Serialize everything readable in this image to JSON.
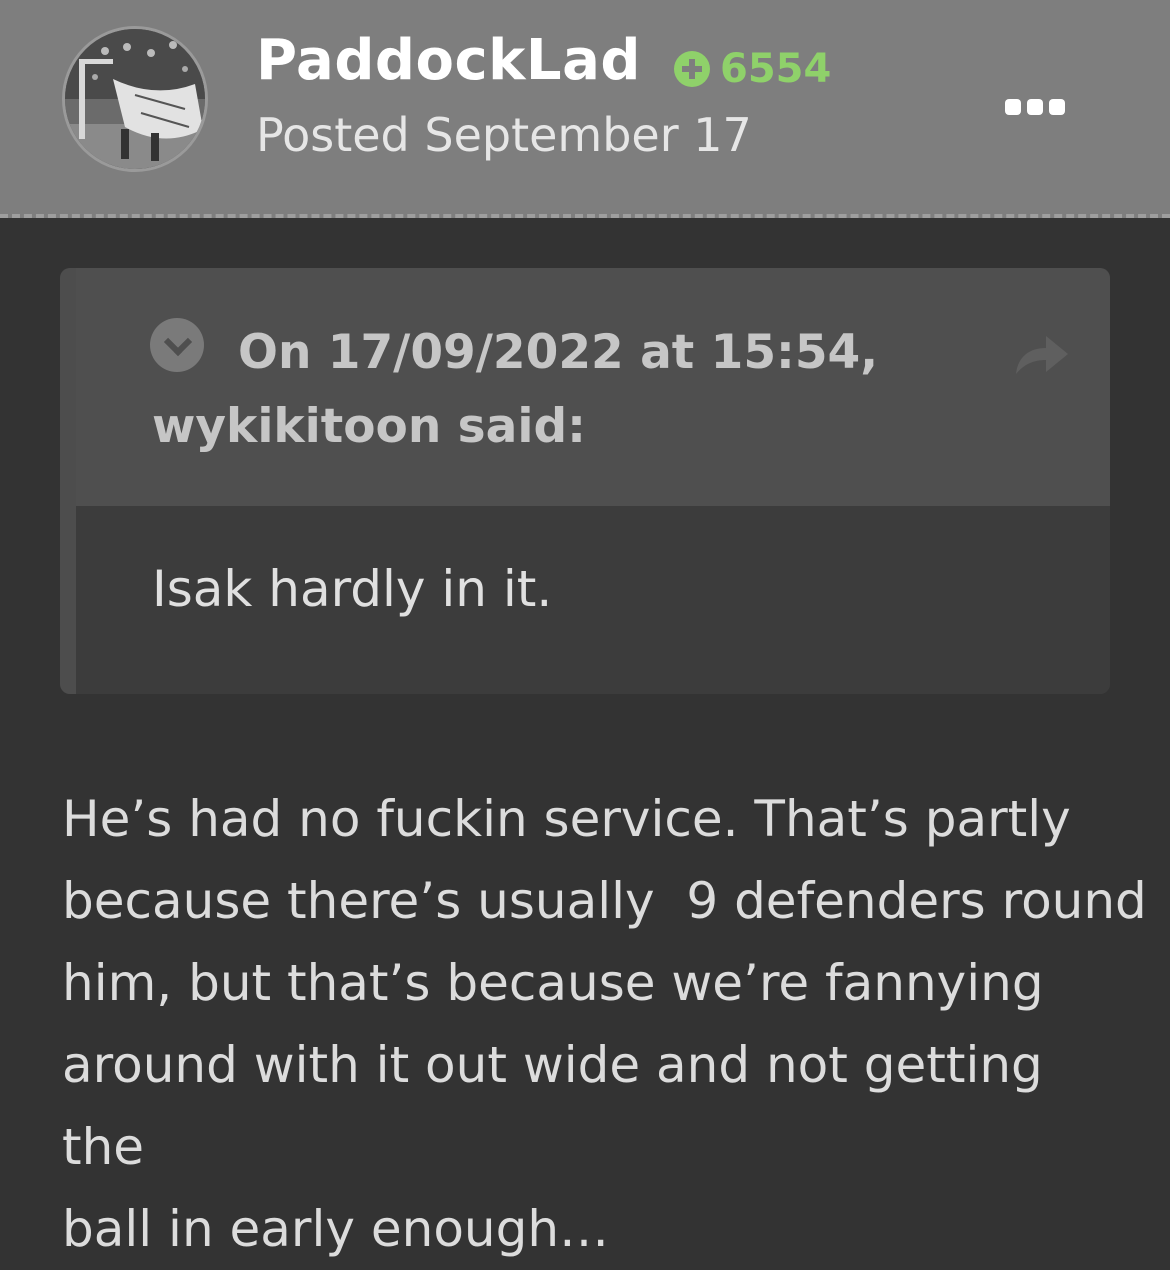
{
  "post": {
    "author": {
      "username": "PaddockLad",
      "reputation": "6554",
      "avatar_icon": "avatar-photo-football-banner"
    },
    "posted": "Posted September 17",
    "more_icon": "ellipsis-icon",
    "quote": {
      "citation_line1": "On 17/09/2022 at 15:54,",
      "citation_line2": "wykikitoon said:",
      "text": "Isak hardly in it.",
      "collapse_icon": "chevron-down-circle-icon",
      "share_icon": "share-arrow-icon"
    },
    "body_lines": [
      "He’s had no fuckin service. That’s partly",
      "because there’s usually  9 defenders round",
      "him, but that’s because we’re fannying",
      "around with it out wide and not getting the",
      "ball in early enough…"
    ]
  },
  "colors": {
    "header_bg": "#7e7e7e",
    "page_bg": "#333333",
    "reputation_green": "#8fd16a",
    "quote_head_bg": "#4f4f4f",
    "quote_body_bg": "#3c3c3c"
  }
}
